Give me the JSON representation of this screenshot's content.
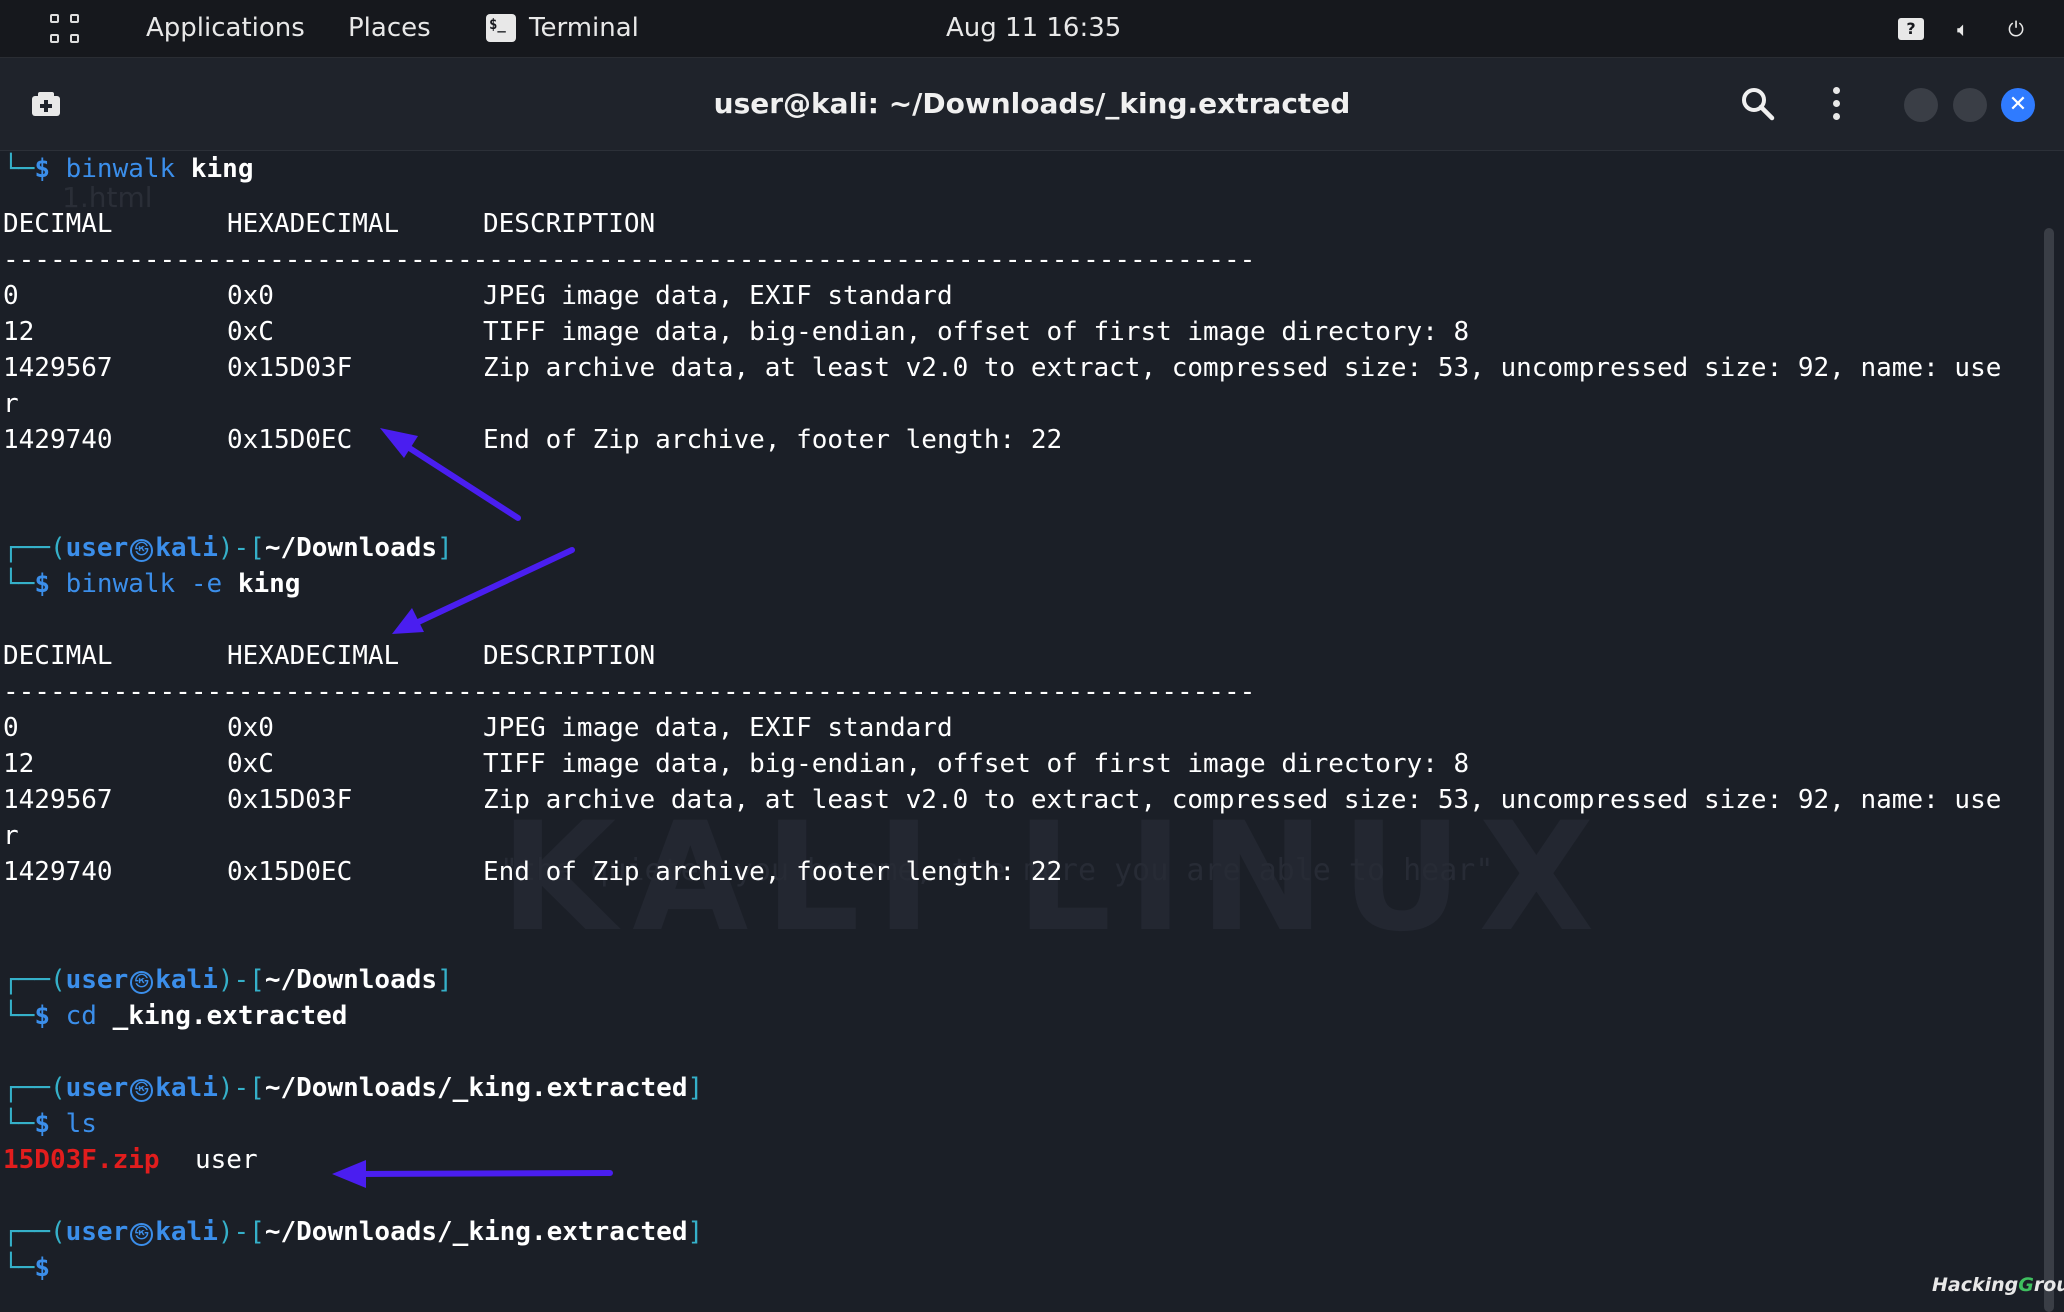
{
  "topbar": {
    "applications": "Applications",
    "places": "Places",
    "active_app": "Terminal",
    "clock": "Aug 11  16:35",
    "icons": [
      "apps-grid-icon",
      "terminal-icon",
      "help-icon",
      "volume-icon",
      "power-icon"
    ]
  },
  "window": {
    "title": "user@kali: ~/Downloads/_king.extracted",
    "icons": [
      "new-tab-icon",
      "search-icon",
      "menu-icon",
      "minimize-icon",
      "maximize-icon",
      "close-icon"
    ]
  },
  "wallpaper": {
    "brand": "KALI LINUX",
    "quote": "\"the quieter you become, the more you are able to hear\"",
    "overlay_text": "1.html"
  },
  "terminal": {
    "cmd1": {
      "command": "binwalk",
      "arg": "king"
    },
    "table_header": {
      "decimal": "DECIMAL",
      "hexadecimal": "HEXADECIMAL",
      "description": "DESCRIPTION"
    },
    "separator": "--------------------------------------------------------------------------------",
    "rows": [
      {
        "decimal": "0",
        "hex": "0x0",
        "desc": "JPEG image data, EXIF standard"
      },
      {
        "decimal": "12",
        "hex": "0xC",
        "desc": "TIFF image data, big-endian, offset of first image directory: 8"
      },
      {
        "decimal": "1429567",
        "hex": "0x15D03F",
        "desc": "Zip archive data, at least v2.0 to extract, compressed size: 53, uncompressed size: 92, name: use"
      },
      {
        "wrap": "r"
      },
      {
        "decimal": "1429740",
        "hex": "0x15D0EC",
        "desc": "End of Zip archive, footer length: 22"
      }
    ],
    "prompt_user": "user",
    "prompt_host": "kali",
    "prompt_symbol": "$",
    "path_downloads": "~/Downloads",
    "path_extracted": "~/Downloads/_king.extracted",
    "cmd2": {
      "command": "binwalk",
      "flag": "-e",
      "arg": "king"
    },
    "cmd3": {
      "command": "cd",
      "arg": "_king.extracted"
    },
    "cmd4": {
      "command": "ls"
    },
    "ls_output": {
      "zip": "15D03F.zip",
      "dir": "user"
    }
  },
  "annotation_color": "#4a1ef0",
  "credit": "HackingGroup"
}
